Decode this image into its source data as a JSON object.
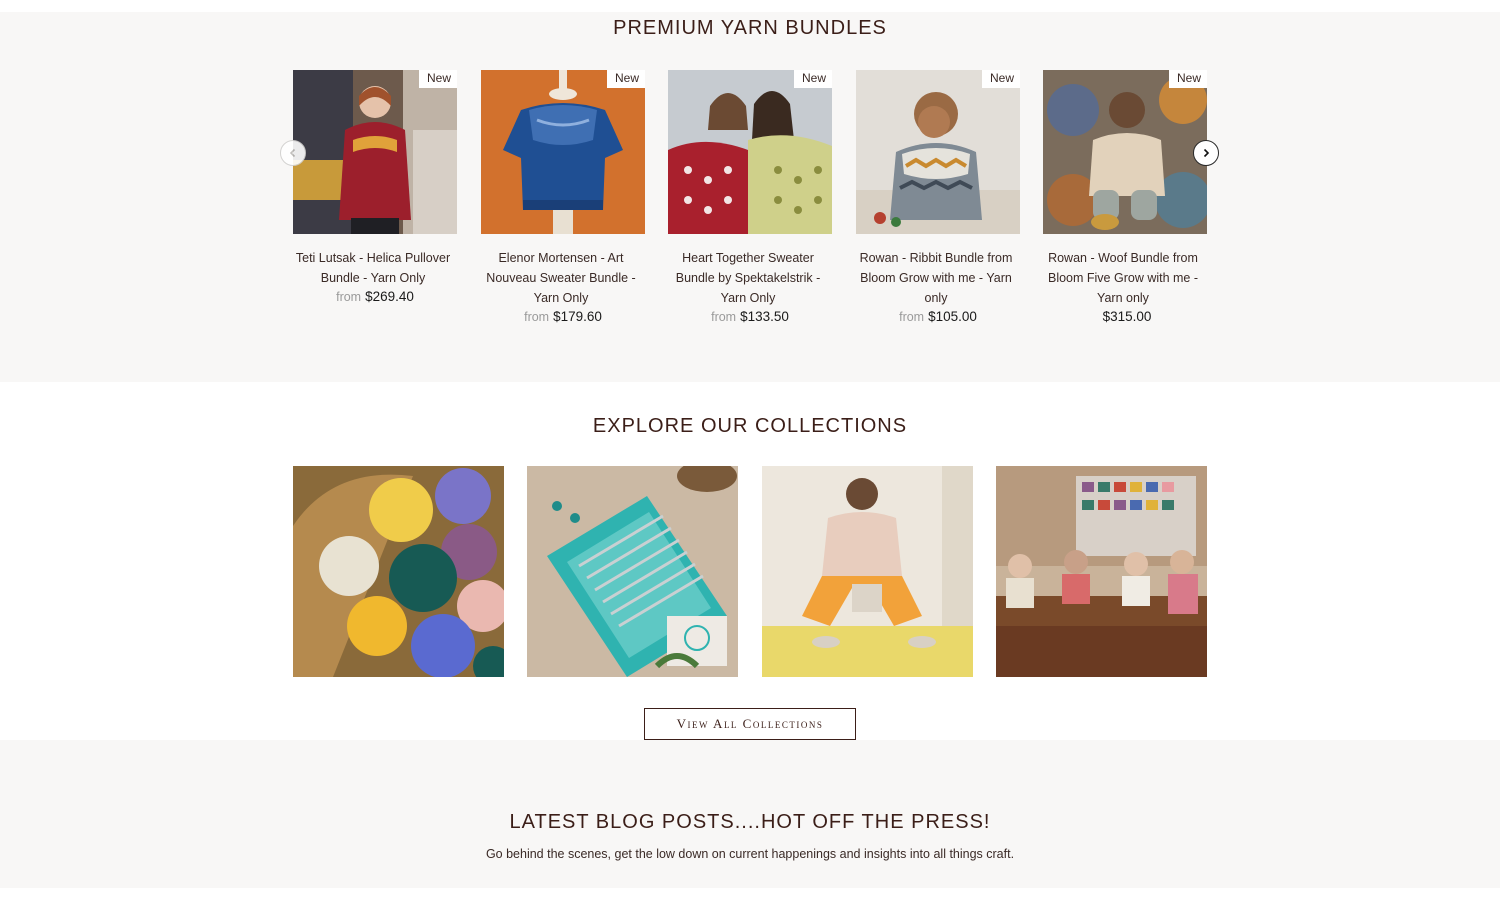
{
  "bundles": {
    "title": "PREMIUM YARN BUNDLES",
    "products": [
      {
        "name": "Teti Lutsak - Helica Pullover Bundle - Yarn Only",
        "from": "from",
        "price": "$269.40",
        "badge": "New"
      },
      {
        "name": "Elenor Mortensen - Art Nouveau Sweater Bundle - Yarn Only",
        "from": "from",
        "price": "$179.60",
        "badge": "New"
      },
      {
        "name": "Heart Together Sweater Bundle by Spektakelstrik - Yarn Only",
        "from": "from",
        "price": "$133.50",
        "badge": "New"
      },
      {
        "name": "Rowan - Ribbit Bundle from Bloom Grow with me - Yarn only",
        "from": "from",
        "price": "$105.00",
        "badge": "New"
      },
      {
        "name": "Rowan - Woof Bundle from Bloom Five Grow with me - Yarn only",
        "from": "",
        "price": "$315.00",
        "badge": "New"
      }
    ]
  },
  "collections": {
    "title": "EXPLORE OUR COLLECTIONS",
    "button": "View All Collections"
  },
  "blog": {
    "title": "LATEST BLOG POSTS....HOT OFF THE PRESS!",
    "subtitle": "Go behind the scenes, get the low down on current happenings and insights into all things craft."
  },
  "colors": {
    "heading": "#3b1e18",
    "section_bg": "#f8f7f6",
    "price": "#1a1a1a",
    "from_text": "#9a9a9a"
  },
  "icons": {
    "prev": "chevron-left-icon",
    "next": "chevron-right-icon"
  }
}
